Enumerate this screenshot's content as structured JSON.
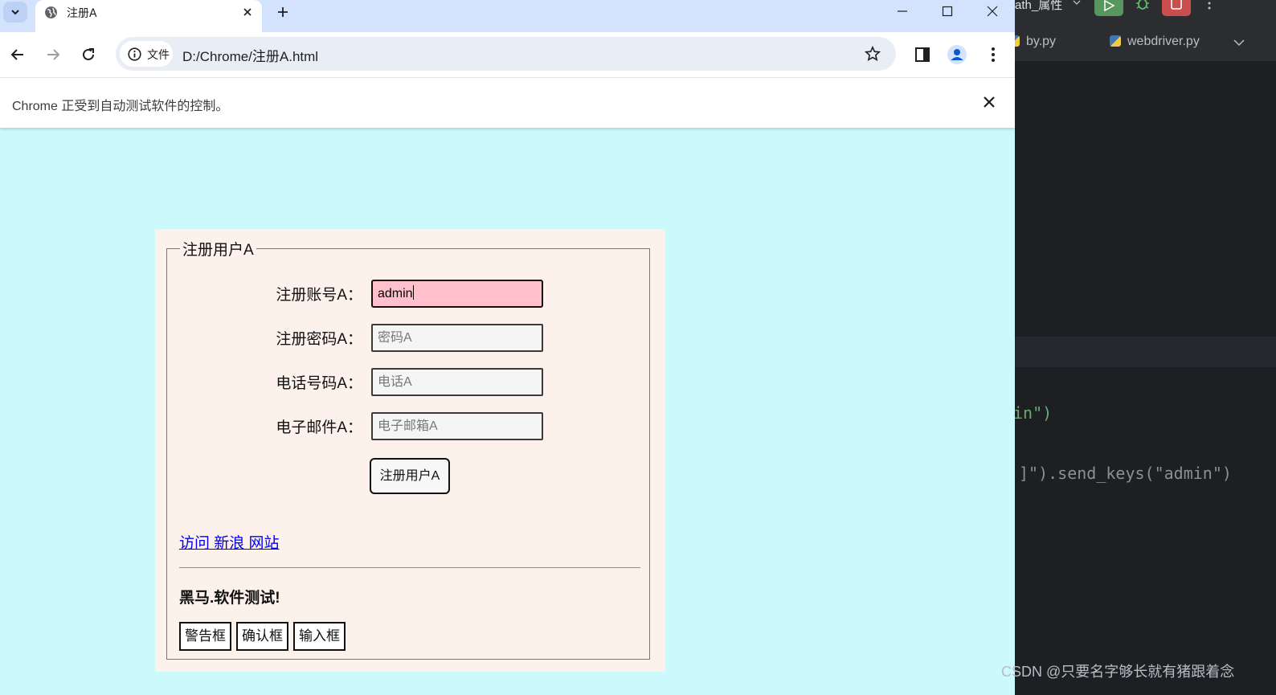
{
  "browser": {
    "tab_title": "注册A",
    "url_chip_label": "文件",
    "url": "D:/Chrome/注册A.html",
    "infobar_message": "Chrome 正受到自动测试软件的控制。"
  },
  "page": {
    "legend": "注册用户A",
    "fields": [
      {
        "label": "注册账号A：",
        "value": "admin",
        "placeholder": ""
      },
      {
        "label": "注册密码A：",
        "value": "",
        "placeholder": "密码A"
      },
      {
        "label": "电话号码A：",
        "value": "",
        "placeholder": "电话A"
      },
      {
        "label": "电子邮件A：",
        "value": "",
        "placeholder": "电子邮箱A"
      }
    ],
    "submit_label": "注册用户A",
    "link_text": "访问 新浪 网站",
    "heading": "黑马.软件测试!",
    "dialog_buttons": [
      "警告框",
      "确认框",
      "输入框"
    ]
  },
  "ide": {
    "title_partial": "ath_属性",
    "file_tabs": [
      "by.py",
      "webdriver.py"
    ],
    "code_lines": [
      "in\")",
      "]\").send_keys(\"admin\")"
    ]
  },
  "watermark": "CSDN @只要名字够长就有猪跟着念",
  "colors": {
    "page_bg": "#cbf9fc",
    "form_bg": "#fdf1ec",
    "filled_input_bg": "#ffc0cb",
    "link": "#0000ee",
    "tabbar": "#d3e3fd",
    "ide_bg": "#1e1f22"
  }
}
